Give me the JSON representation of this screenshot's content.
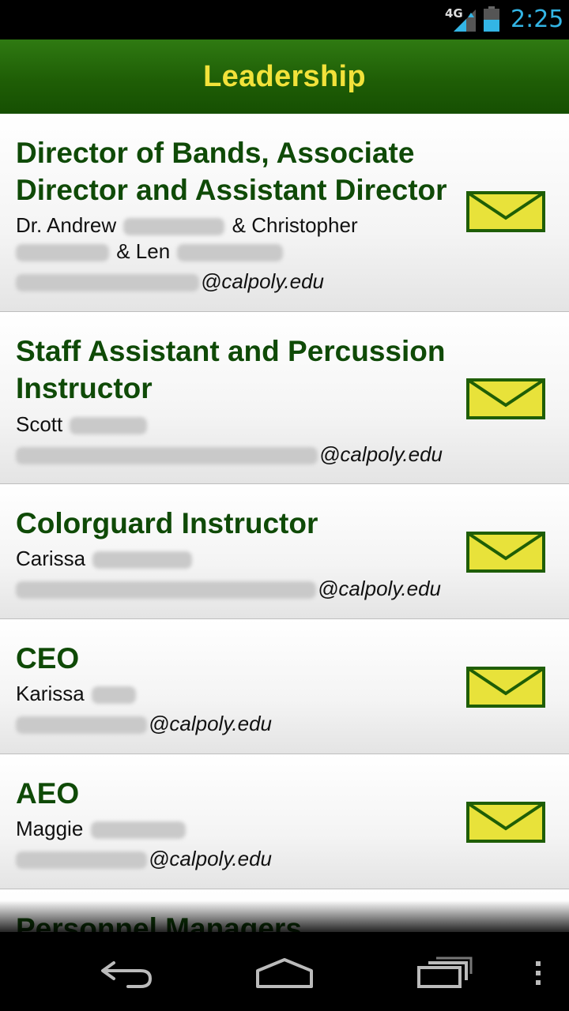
{
  "status_bar": {
    "network": "4G",
    "clock": "2:25",
    "icons": [
      "signal-icon",
      "battery-icon"
    ],
    "accent_color": "#33b5e5"
  },
  "header": {
    "title": "Leadership",
    "title_color": "#f2e23a",
    "bar_color": "#1f5e06"
  },
  "leaders": [
    {
      "role": "Director of Bands, Associate Director and Assistant Director",
      "person_first": "Dr. Andrew",
      "person_mid": "& Christopher",
      "person_last": "& Len",
      "email_domain": "@calpoly.edu",
      "icon": "mail-icon"
    },
    {
      "role": "Staff Assistant and Percussion Instructor",
      "person_first": "Scott",
      "email_domain": "@calpoly.edu",
      "icon": "mail-icon"
    },
    {
      "role": "Colorguard Instructor",
      "person_first": "Carissa",
      "email_domain": "@calpoly.edu",
      "icon": "mail-icon"
    },
    {
      "role": "CEO",
      "person_first": "Karissa",
      "email_domain": "@calpoly.edu",
      "icon": "mail-icon"
    },
    {
      "role": "AEO",
      "person_first": "Maggie",
      "email_domain": "@calpoly.edu",
      "icon": "mail-icon"
    },
    {
      "role": "Personnel Managers"
    }
  ],
  "nav_bar": {
    "icons": [
      "back-icon",
      "home-icon",
      "recent-apps-icon",
      "overflow-menu-icon"
    ]
  }
}
